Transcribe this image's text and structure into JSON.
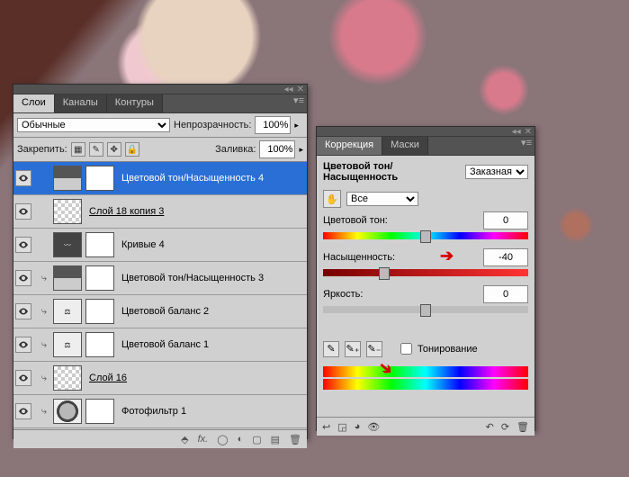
{
  "layers_panel": {
    "tabs": [
      "Слои",
      "Каналы",
      "Контуры"
    ],
    "active_tab": 0,
    "blend_mode": "Обычные",
    "opacity_label": "Непрозрачность:",
    "opacity_value": "100%",
    "lock_label": "Закрепить:",
    "fill_label": "Заливка:",
    "fill_value": "100%",
    "layers": [
      {
        "name": "Цветовой тон/Насыщенность 4",
        "selected": true,
        "kind": "adj"
      },
      {
        "name": "Слой 18 копия 3",
        "selected": false,
        "kind": "chk",
        "underline": true
      },
      {
        "name": "Кривые 4",
        "selected": false,
        "kind": "curve"
      },
      {
        "name": "Цветовой тон/Насыщенность 3",
        "selected": false,
        "kind": "adj",
        "clip": true
      },
      {
        "name": "Цветовой баланс 2",
        "selected": false,
        "kind": "balance",
        "clip": true
      },
      {
        "name": "Цветовой баланс 1",
        "selected": false,
        "kind": "balance",
        "clip": true
      },
      {
        "name": "Слой 16",
        "selected": false,
        "kind": "chk",
        "clip": true,
        "underline": true
      },
      {
        "name": "Фотофильтр 1",
        "selected": false,
        "kind": "lens",
        "clip": true
      }
    ]
  },
  "adjust_panel": {
    "tabs": [
      "Коррекция",
      "Маски"
    ],
    "active_tab": 0,
    "title": "Цветовой тон/Насыщенность",
    "preset": "Заказная",
    "edit_dropdown": "Все",
    "hue_label": "Цветовой тон:",
    "hue_value": "0",
    "sat_label": "Насыщенность:",
    "sat_value": "-40",
    "light_label": "Яркость:",
    "light_value": "0",
    "colorize_label": "Тонирование"
  }
}
